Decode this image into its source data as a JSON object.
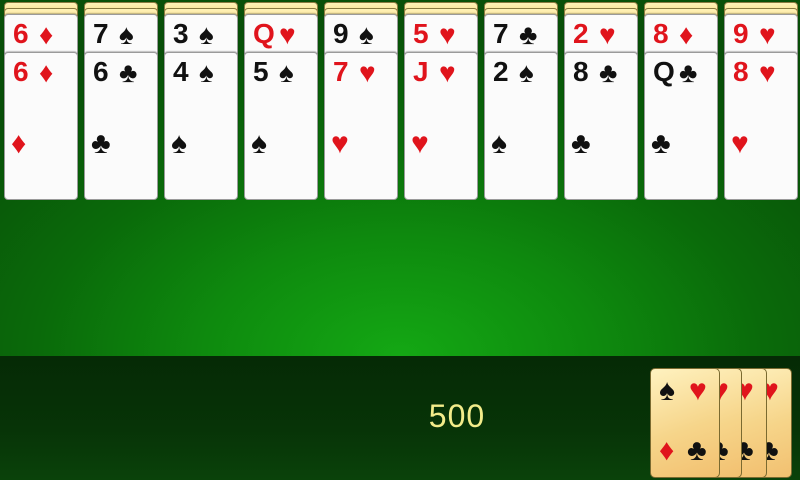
{
  "game": {
    "score": "500"
  },
  "tableau": [
    {
      "under": {
        "rank": "6",
        "suit": "♦",
        "color": "red"
      },
      "top": {
        "rank": "6",
        "suit": "♦",
        "color": "red"
      }
    },
    {
      "under": {
        "rank": "7",
        "suit": "♠",
        "color": "black"
      },
      "top": {
        "rank": "6",
        "suit": "♣",
        "color": "black"
      }
    },
    {
      "under": {
        "rank": "3",
        "suit": "♠",
        "color": "black"
      },
      "top": {
        "rank": "4",
        "suit": "♠",
        "color": "black"
      }
    },
    {
      "under": {
        "rank": "Q",
        "suit": "♥",
        "color": "red"
      },
      "top": {
        "rank": "5",
        "suit": "♠",
        "color": "black"
      }
    },
    {
      "under": {
        "rank": "9",
        "suit": "♠",
        "color": "black"
      },
      "top": {
        "rank": "7",
        "suit": "♥",
        "color": "red"
      }
    },
    {
      "under": {
        "rank": "5",
        "suit": "♥",
        "color": "red"
      },
      "top": {
        "rank": "J",
        "suit": "♥",
        "color": "red"
      }
    },
    {
      "under": {
        "rank": "7",
        "suit": "♣",
        "color": "black"
      },
      "top": {
        "rank": "2",
        "suit": "♠",
        "color": "black"
      }
    },
    {
      "under": {
        "rank": "2",
        "suit": "♥",
        "color": "red"
      },
      "top": {
        "rank": "8",
        "suit": "♣",
        "color": "black"
      }
    },
    {
      "under": {
        "rank": "8",
        "suit": "♦",
        "color": "red"
      },
      "top": {
        "rank": "Q",
        "suit": "♣",
        "color": "black"
      }
    },
    {
      "under": {
        "rank": "9",
        "suit": "♥",
        "color": "red"
      },
      "top": {
        "rank": "8",
        "suit": "♥",
        "color": "red"
      }
    }
  ],
  "stock": {
    "pile_count": 4,
    "suits": {
      "tl": "♠",
      "tr": "♥",
      "bl": "♦",
      "br": "♣"
    }
  },
  "colors": {
    "felt": "#0e8a0e",
    "red": "#e0141c",
    "score": "#f2ec8a"
  }
}
